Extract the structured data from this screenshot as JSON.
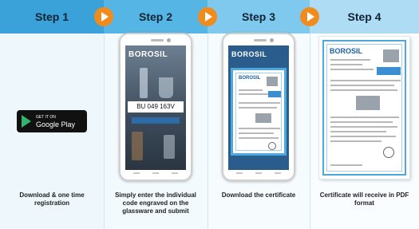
{
  "steps": [
    {
      "title": "Step 1",
      "caption": "Download & one time registration"
    },
    {
      "title": "Step 2",
      "caption": "Simply enter the individual code engraved on the glassware and submit"
    },
    {
      "title": "Step 3",
      "caption": "Download the certificate"
    },
    {
      "title": "Step 4",
      "caption": "Certificate will receive in PDF format"
    }
  ],
  "play_badge": {
    "small": "GET IT ON",
    "big": "Google Play"
  },
  "phone_step2": {
    "brand": "BOROSIL",
    "code": "BU 049 163V"
  },
  "phone_step3": {
    "brand": "BOROSIL"
  },
  "certificate": {
    "brand": "BOROSIL"
  },
  "colors": {
    "accent_arrow": "#f08c1e",
    "header_blue": "#3aa2d8",
    "cert_border": "#4fa8dc"
  },
  "icons": [
    "chevron-right-icon",
    "google-play-icon"
  ]
}
